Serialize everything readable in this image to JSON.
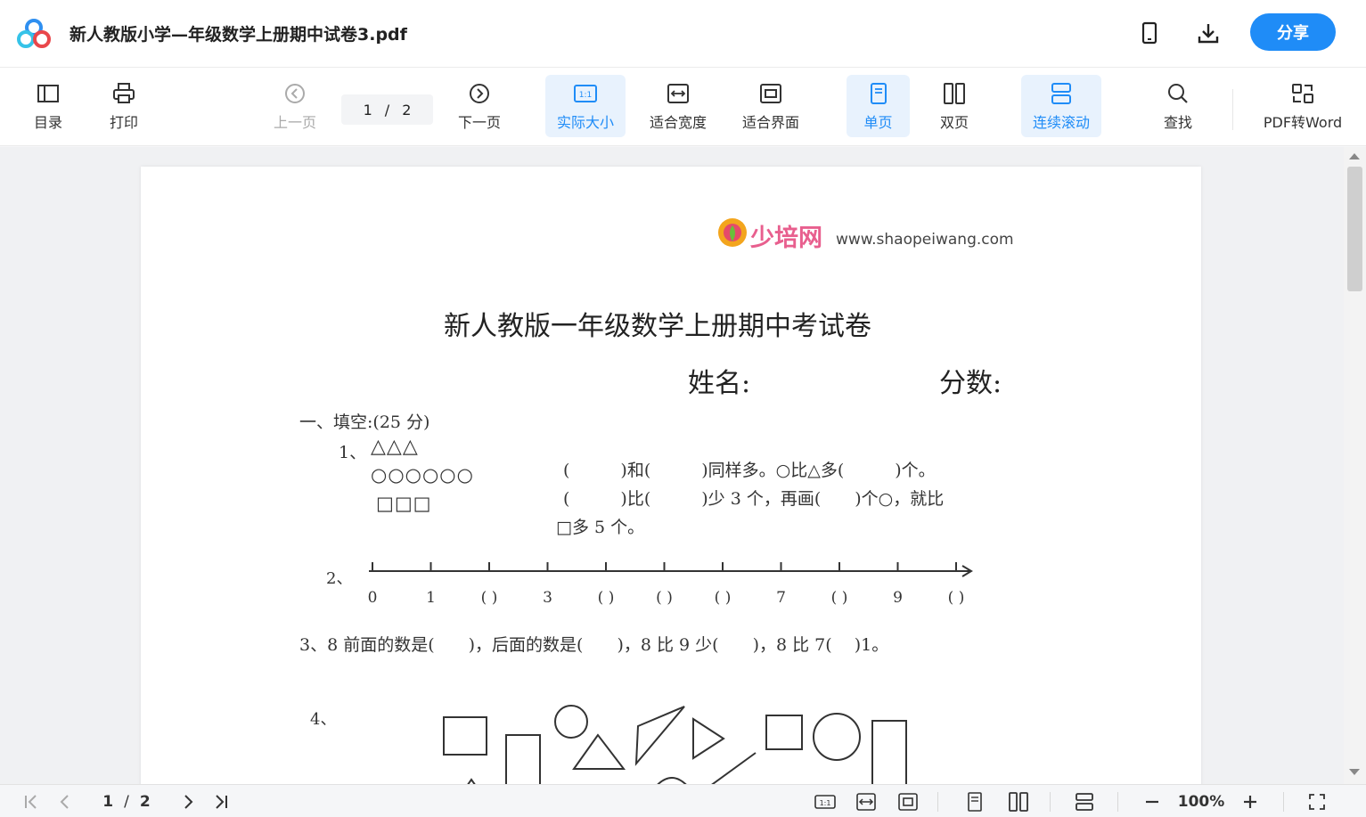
{
  "titlebar": {
    "title": "新人教版小学—年级数学上册期中试卷3.pdf",
    "share_label": "分享"
  },
  "toolbar": {
    "toc": "目录",
    "print": "打印",
    "prev": "上一页",
    "page_current": "1",
    "page_sep": "/",
    "page_total": "2",
    "next": "下一页",
    "actual_size": "实际大小",
    "fit_width": "适合宽度",
    "fit_page": "适合界面",
    "single": "单页",
    "double": "双页",
    "continuous": "连续滚动",
    "find": "查找",
    "pdf2word": "PDF转Word",
    "actual_icon_text": "1:1"
  },
  "document": {
    "watermark_site": "www.shaopeiwang.com",
    "watermark_brand": "少培网",
    "exam_title": "新人教版一年级数学上册期中考试卷",
    "name_label": "姓名:",
    "score_label": "分数:",
    "section1": "一、填空:(25 分)",
    "q1_label": "1、",
    "q1_shapes_row1": "△△△",
    "q1_shapes_row2": "○○○○○○",
    "q1_shapes_row3": "□□□",
    "q1_line1": "(　　　)和(　　　)同样多。○比△多(　　　)个。",
    "q1_line2": "(　　　)比(　　　)少 3 个，再画(　　)个○，就比",
    "q1_line3": "□多 5 个。",
    "q2_label": "2、",
    "q2_ticks": [
      "0",
      "1",
      "(  )",
      "3",
      "(  )",
      "(  )",
      "(  )",
      "7",
      "(  )",
      "9",
      "(  )"
    ],
    "q3": "3、8 前面的数是(　　)，后面的数是(　　)，8 比 9 少(　　)，8 比 7(　 )1。",
    "q4_label": "4、"
  },
  "bottombar": {
    "page_current": "1",
    "page_sep": "/",
    "page_total": "2",
    "zoom": "100%",
    "actual_icon_text": "1:1"
  },
  "colors": {
    "accent": "#1f8cf7",
    "active_bg": "#e8f2fd"
  }
}
